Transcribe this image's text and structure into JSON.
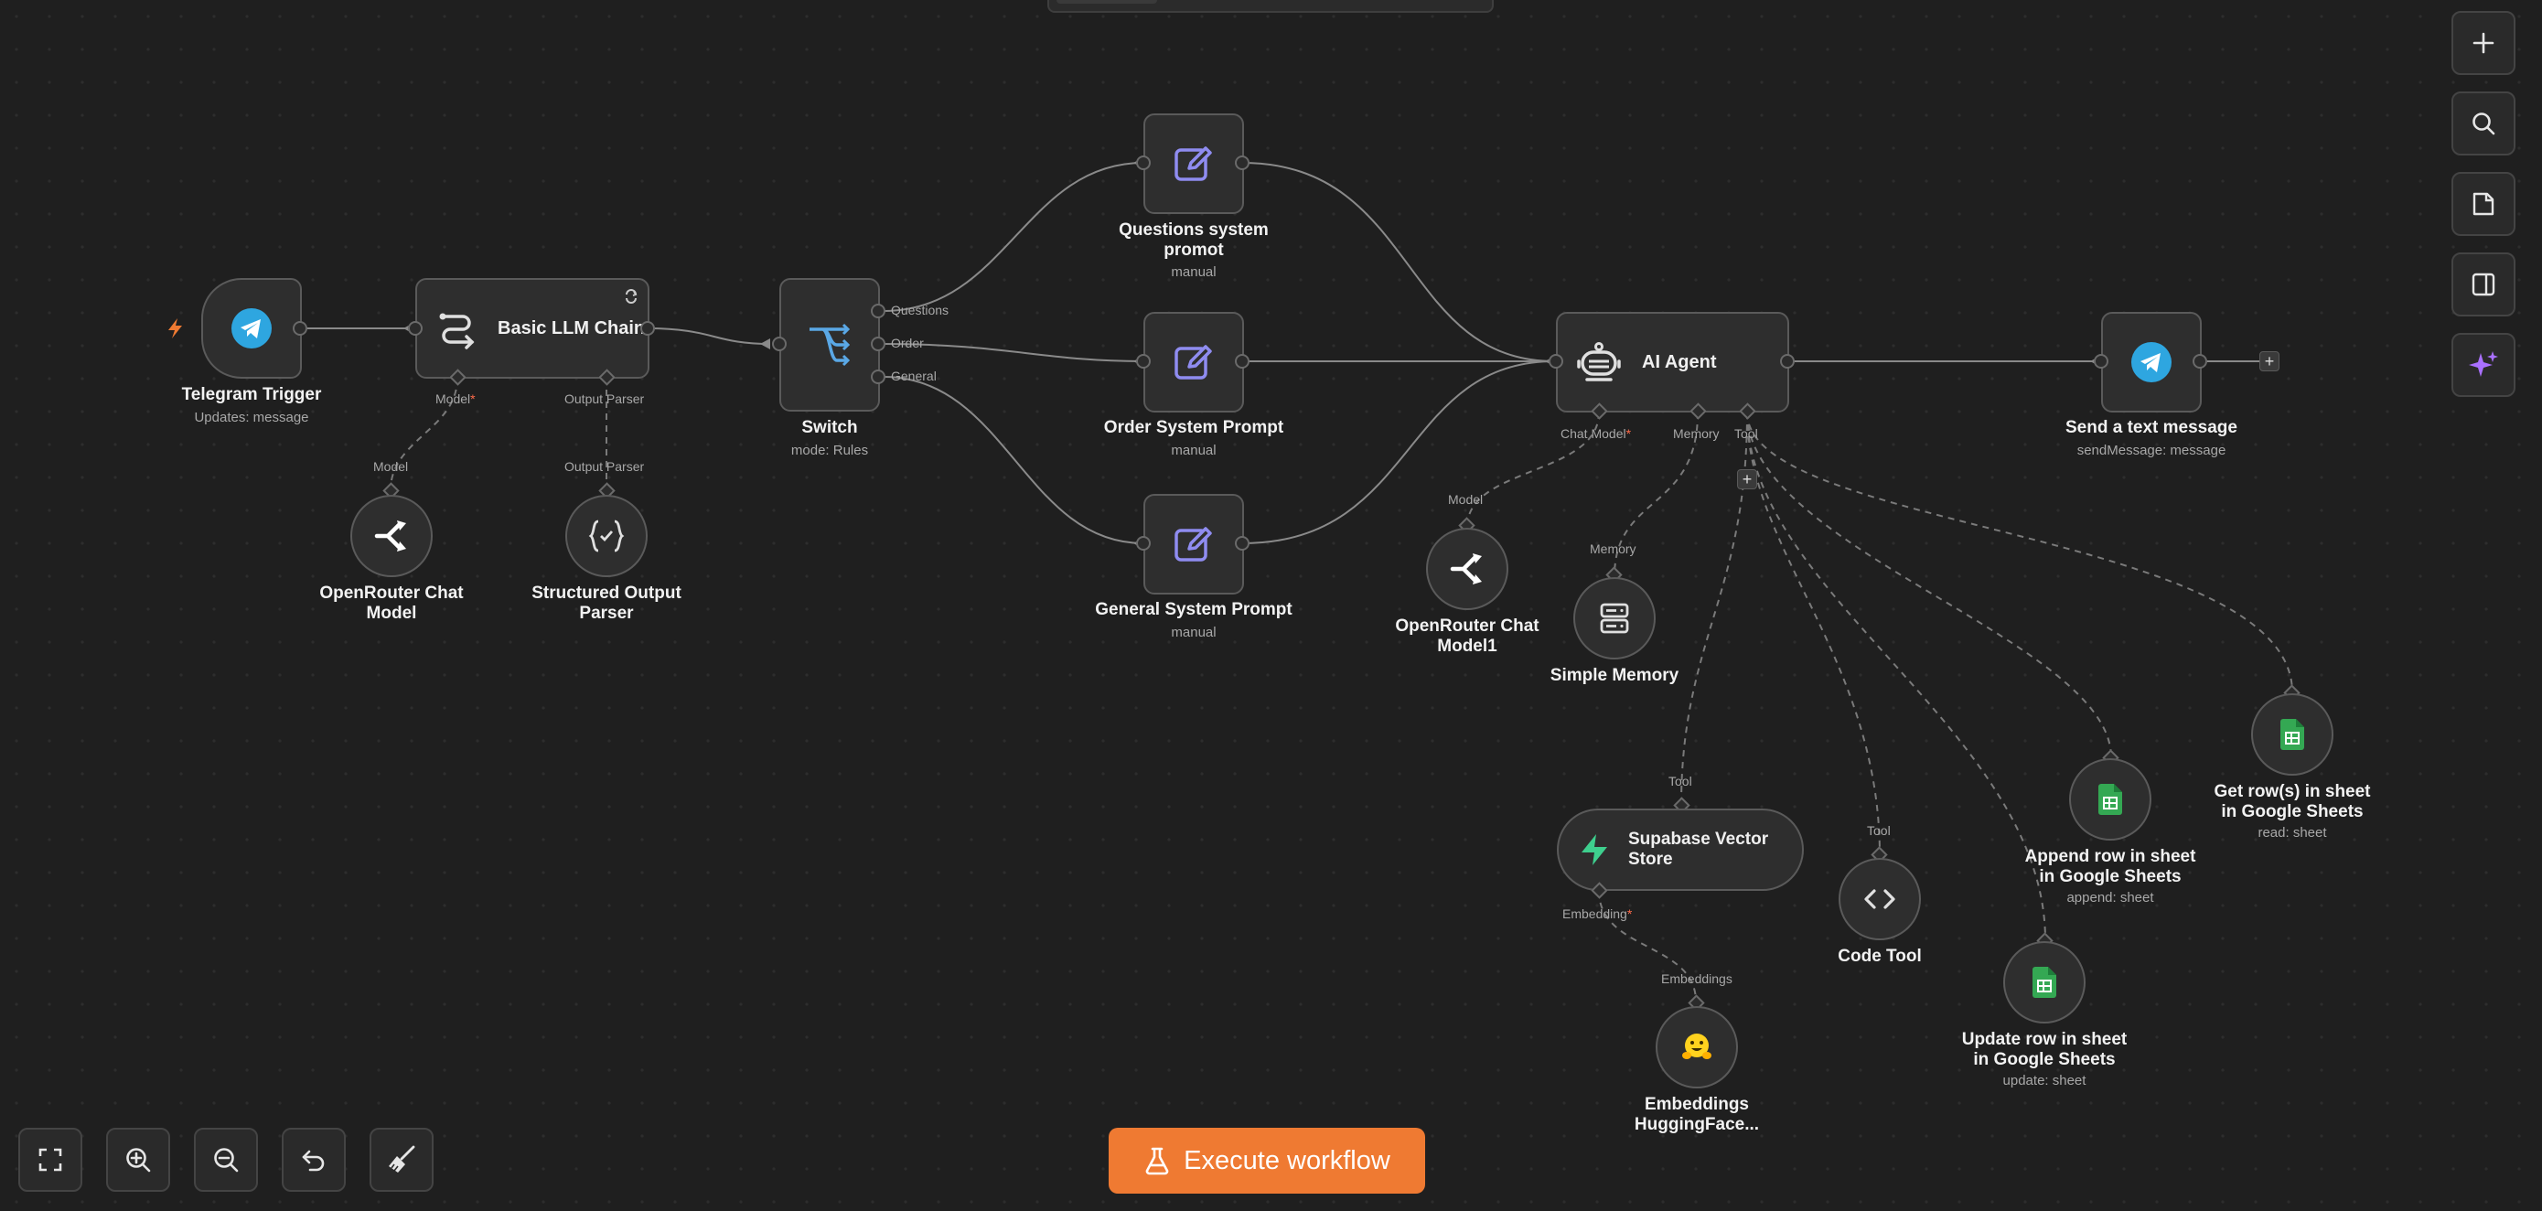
{
  "colors": {
    "canvas": "#1f1f1f",
    "node_fill": "#2e2e2e",
    "node_border": "#5a5a5a",
    "edge": "#8a8a8a",
    "accent_orange": "#ef7a32",
    "telegram_blue": "#2ea6e0",
    "prompt_purple": "#8f8cf0",
    "switch_blue": "#5aa8e6",
    "sheets_green": "#34a853",
    "supabase_green": "#3ecf8e",
    "ai_purple": "#a970ff"
  },
  "nodes": {
    "telegram_trigger": {
      "label": "Telegram Trigger",
      "sub": "Updates: message",
      "icon": "telegram-icon"
    },
    "basic_llm_chain": {
      "label": "Basic LLM Chain",
      "icon": "chain-icon",
      "port_model": "Model",
      "port_parser": "Output Parser"
    },
    "openrouter_model": {
      "label_1": "OpenRouter Chat",
      "label_2": "Model",
      "port": "Model",
      "icon": "openrouter-icon"
    },
    "structured_parser": {
      "label_1": "Structured Output",
      "label_2": "Parser",
      "port": "Output Parser",
      "icon": "braces-icon"
    },
    "switch": {
      "label": "Switch",
      "sub": "mode: Rules",
      "out_1": "Questions",
      "out_2": "Order",
      "out_3": "General",
      "icon": "switch-icon"
    },
    "questions_prompt": {
      "label_1": "Questions system",
      "label_2": "promot",
      "sub": "manual",
      "icon": "edit-icon"
    },
    "order_prompt": {
      "label": "Order System Prompt",
      "sub": "manual",
      "icon": "edit-icon"
    },
    "general_prompt": {
      "label": "General System Prompt",
      "sub": "manual",
      "icon": "edit-icon"
    },
    "ai_agent": {
      "label": "AI Agent",
      "port_chat": "Chat Model",
      "port_memory": "Memory",
      "port_tool": "Tool",
      "icon": "robot-icon"
    },
    "openrouter_model1": {
      "label_1": "OpenRouter Chat",
      "label_2": "Model1",
      "port": "Model",
      "icon": "openrouter-icon"
    },
    "simple_memory": {
      "label": "Simple Memory",
      "port": "Memory",
      "icon": "database-icon"
    },
    "supabase": {
      "label_1": "Supabase Vector",
      "label_2": "Store",
      "port_top": "Tool",
      "port_bottom": "Embedding",
      "icon": "supabase-icon"
    },
    "embeddings": {
      "label_1": "Embeddings",
      "label_2": "HuggingFace...",
      "port": "Embeddings",
      "icon": "huggingface-icon"
    },
    "code_tool": {
      "label": "Code Tool",
      "port": "Tool",
      "icon": "code-icon"
    },
    "update_row": {
      "label_1": "Update row in sheet",
      "label_2": "in Google Sheets",
      "sub": "update: sheet",
      "icon": "sheets-icon"
    },
    "append_row": {
      "label_1": "Append row in sheet",
      "label_2": "in Google Sheets",
      "sub": "append: sheet",
      "icon": "sheets-icon"
    },
    "get_rows": {
      "label_1": "Get row(s) in sheet",
      "label_2": "in Google Sheets",
      "sub": "read: sheet",
      "icon": "sheets-icon"
    },
    "send_message": {
      "label": "Send a text message",
      "sub": "sendMessage: message",
      "icon": "telegram-icon"
    }
  },
  "toolbar_right": [
    {
      "name": "add-node-button",
      "icon": "plus-icon"
    },
    {
      "name": "search-button",
      "icon": "search-icon"
    },
    {
      "name": "sticky-note-button",
      "icon": "note-icon"
    },
    {
      "name": "toggle-panel-button",
      "icon": "panel-icon"
    },
    {
      "name": "ai-assistant-button",
      "icon": "sparkle-icon"
    }
  ],
  "toolbar_bottom": [
    {
      "name": "fit-view-button",
      "icon": "fullscreen-icon"
    },
    {
      "name": "zoom-in-button",
      "icon": "zoom-in-icon"
    },
    {
      "name": "zoom-out-button",
      "icon": "zoom-out-icon"
    },
    {
      "name": "undo-button",
      "icon": "undo-icon"
    },
    {
      "name": "tidy-up-button",
      "icon": "broom-icon"
    }
  ],
  "execute": {
    "label": "Execute workflow",
    "icon": "flask-icon"
  }
}
